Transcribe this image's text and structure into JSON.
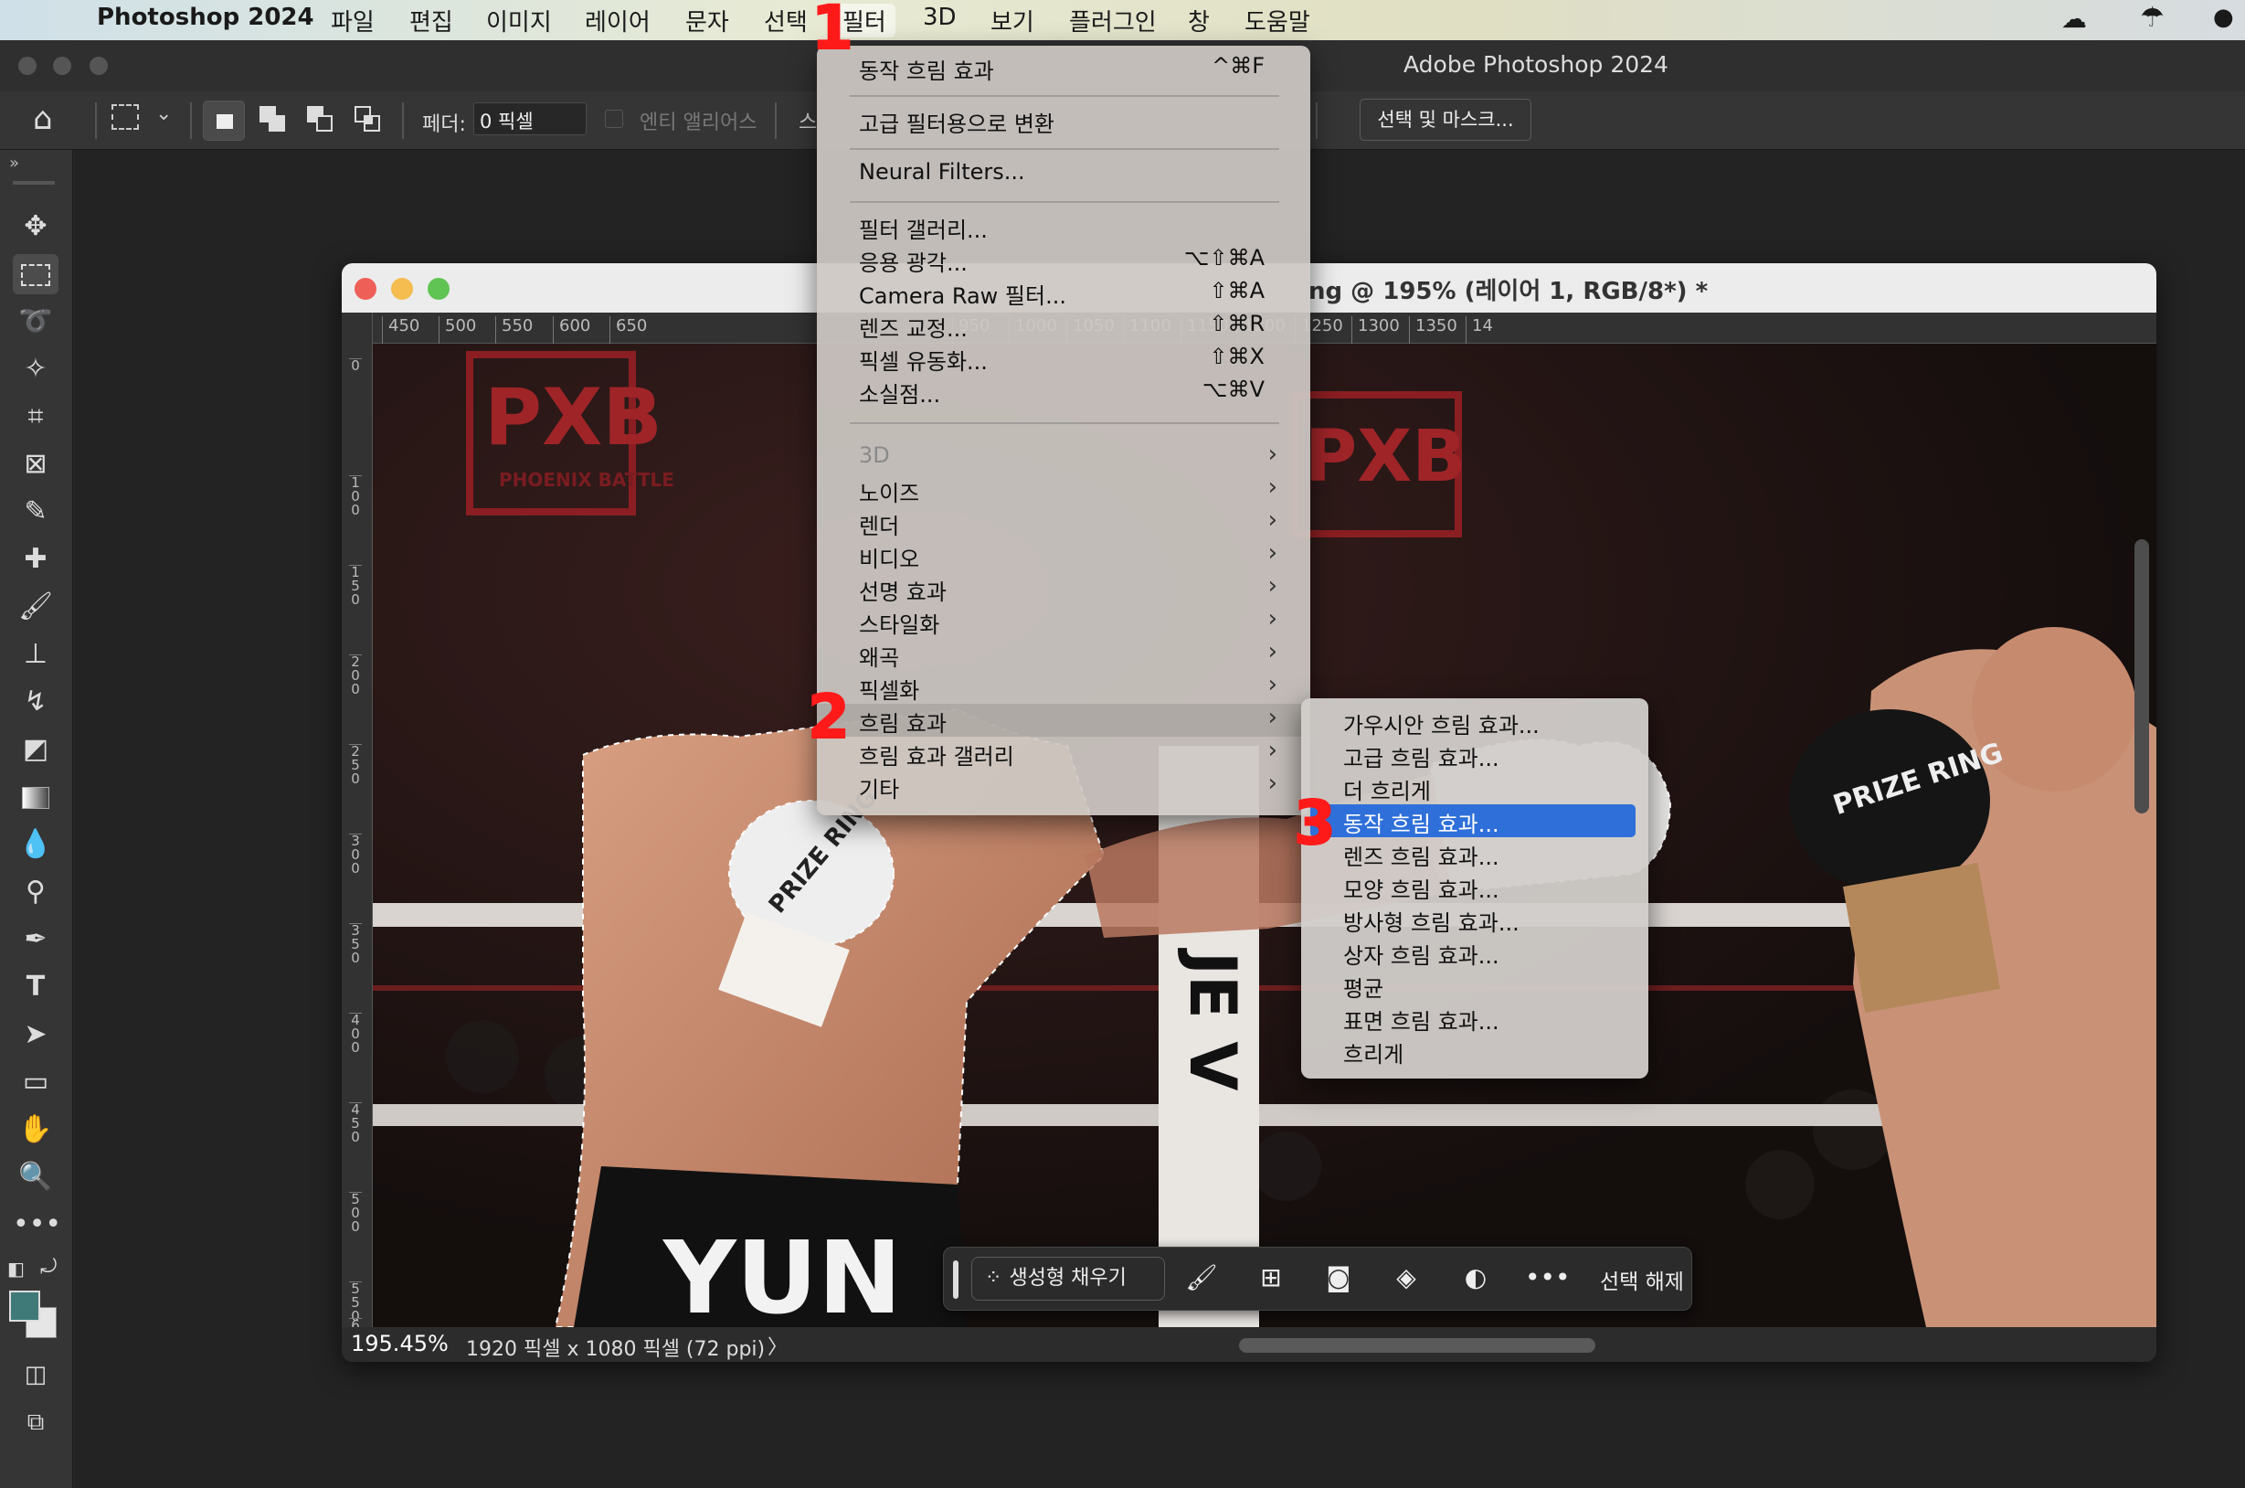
{
  "menubar": {
    "app_name": "Photoshop 2024",
    "items": [
      "파일",
      "편집",
      "이미지",
      "레이어",
      "문자",
      "선택",
      "필터",
      "3D",
      "보기",
      "플러그인",
      "창",
      "도움말"
    ]
  },
  "window": {
    "title": "Adobe Photoshop 2024"
  },
  "options_bar": {
    "feather_label": "페더:",
    "feather_value": "0 픽셀",
    "antialias_label": "엔티 앨리어스",
    "partial_label": "스",
    "select_mask_button": "선택 및 마스크..."
  },
  "document": {
    "title": "ng @ 195% (레이어 1, RGB/8*) *",
    "ruler_h": [
      "450",
      "500",
      "550",
      "600",
      "650",
      "950",
      "1000",
      "1050",
      "1100",
      "1150",
      "1200",
      "1250",
      "1300",
      "1350",
      "14"
    ],
    "ruler_v": [
      "0",
      "100",
      "150",
      "200",
      "250",
      "300",
      "350",
      "400",
      "450",
      "500",
      "550",
      "6"
    ],
    "photo": {
      "sign_text": "PXB",
      "sign_subtext": "PHOENIX BATTLE",
      "glove_text": "PRIZE RING",
      "shorts_text": "YUN",
      "post_text": "JE V"
    }
  },
  "status_bar": {
    "zoom": "195.45%",
    "info": "1920 픽셀 x 1080 픽셀 (72 ppi)",
    "arrow": "〉"
  },
  "context_bar": {
    "generative_fill": "생성형 채우기",
    "deselect": "선택 해제"
  },
  "filter_menu": {
    "items": [
      {
        "label": "동작 흐림 효과",
        "shortcut": "^⌘F"
      },
      {
        "label": "고급 필터용으로 변환"
      },
      {
        "label": "Neural Filters..."
      },
      {
        "label": "필터 갤러리..."
      },
      {
        "label": "응용 광각...",
        "shortcut": "⌥⇧⌘A"
      },
      {
        "label": "Camera Raw 필터...",
        "shortcut": "⇧⌘A"
      },
      {
        "label": "렌즈 교정...",
        "shortcut": "⇧⌘R"
      },
      {
        "label": "픽셀 유동화...",
        "shortcut": "⇧⌘X"
      },
      {
        "label": "소실점...",
        "shortcut": "⌥⌘V"
      },
      {
        "label": "3D"
      },
      {
        "label": "노이즈"
      },
      {
        "label": "렌더"
      },
      {
        "label": "비디오"
      },
      {
        "label": "선명 효과"
      },
      {
        "label": "스타일화"
      },
      {
        "label": "왜곡"
      },
      {
        "label": "픽셀화"
      },
      {
        "label": "흐림 효과"
      },
      {
        "label": "흐림 효과 갤러리"
      },
      {
        "label": "기타"
      }
    ]
  },
  "blur_submenu": {
    "items": [
      "가우시안 흐림 효과...",
      "고급 흐림 효과...",
      "더 흐리게",
      "동작 흐림 효과...",
      "렌즈 흐림 효과...",
      "모양 흐림 효과...",
      "방사형 흐림 효과...",
      "상자 흐림 효과...",
      "평균",
      "표면 흐림 효과...",
      "흐리게"
    ]
  },
  "annotations": {
    "step1": "1",
    "step2": "2",
    "step3": "3"
  },
  "colors": {
    "accent": "#2f6fd9",
    "annotation": "#ff1a1a",
    "foreground_swatch": "#3f7a78"
  },
  "icons": [
    "apple-icon",
    "home-icon",
    "move-icon",
    "marquee-icon",
    "lasso-icon",
    "magic-wand-icon",
    "crop-icon",
    "frame-icon",
    "eyedropper-icon",
    "healing-icon",
    "brush-icon",
    "stamp-icon",
    "history-brush-icon",
    "eraser-icon",
    "gradient-icon",
    "blur-icon",
    "dodge-icon",
    "pen-icon",
    "type-icon",
    "path-select-icon",
    "rectangle-icon",
    "hand-icon",
    "zoom-icon",
    "more-icon"
  ]
}
